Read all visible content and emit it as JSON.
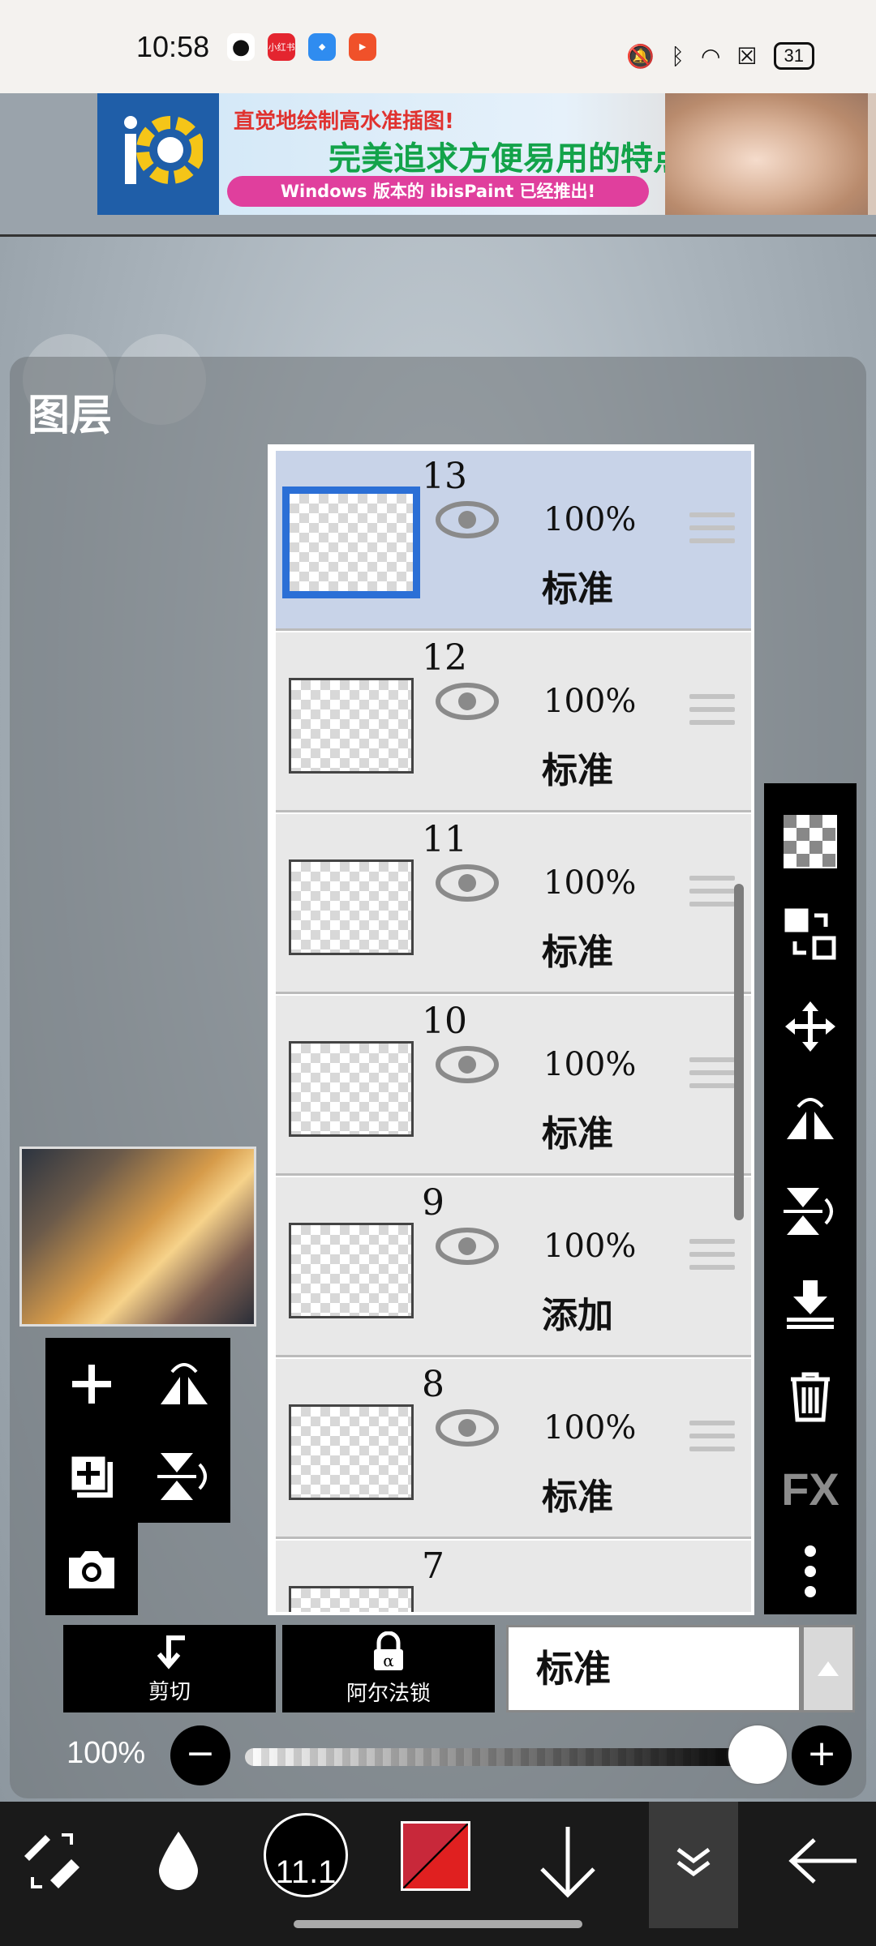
{
  "status_bar": {
    "time": "10:58",
    "apps": [
      "wechat-icon",
      "xiaohongshu-icon",
      "feishu-icon",
      "video-icon"
    ],
    "xiaohongshu_label": "小红书",
    "battery": "31"
  },
  "ad": {
    "line1": "直觉地绘制高水准插图!",
    "line2": "完美追求方便易用的特点!",
    "line3": "Windows 版本的 ibisPaint 已经推出!"
  },
  "panel": {
    "title": "图层"
  },
  "layers": [
    {
      "number": "13",
      "opacity": "100%",
      "blend": "标准",
      "selected": true
    },
    {
      "number": "12",
      "opacity": "100%",
      "blend": "标准",
      "selected": false
    },
    {
      "number": "11",
      "opacity": "100%",
      "blend": "标准",
      "selected": false
    },
    {
      "number": "10",
      "opacity": "100%",
      "blend": "标准",
      "selected": false
    },
    {
      "number": "9",
      "opacity": "100%",
      "blend": "添加",
      "selected": false
    },
    {
      "number": "8",
      "opacity": "100%",
      "blend": "标准",
      "selected": false
    },
    {
      "number": "7",
      "opacity": "",
      "blend": "",
      "selected": false
    }
  ],
  "right_tools": {
    "fx_label": "FX"
  },
  "bottom_panel": {
    "cut_label": "剪切",
    "alpha_lock_label": "阿尔法锁",
    "blend_mode_value": "标准",
    "opacity_value": "100%",
    "opacity_fraction": 1.0,
    "minus": "−",
    "plus": "+"
  },
  "toolbar": {
    "brush_size": "11.1",
    "primary_color": "#d8262d"
  }
}
